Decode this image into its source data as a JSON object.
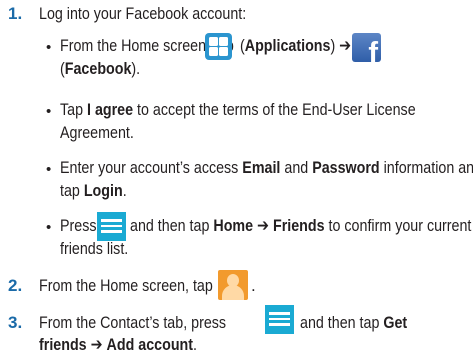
{
  "steps": [
    {
      "number": "1.",
      "text": "Log into your Facebook account:"
    },
    {
      "number": "2.",
      "text": "From the Home screen, tap",
      "end": "."
    },
    {
      "number": "3.",
      "line1_a": "From the Contact’s tab, press",
      "line1_b": "and then tap",
      "get": "Get",
      "friends": "friends",
      "arrow": "➔",
      "add_account": "Add account",
      "end": "."
    }
  ],
  "bullets": {
    "symbol": "•",
    "b1": {
      "a": "From the Home screen, tap",
      "paren_open": "(",
      "applications": "Applications",
      "paren_close_arrow": ") ➔",
      "line2_open": "(",
      "facebook": "Facebook",
      "line2_close": ")."
    },
    "b2": {
      "a": "Tap",
      "agree": "I agree",
      "b": "to accept the terms of the End-User License",
      "line2": "Agreement."
    },
    "b3": {
      "a": "Enter your account’s access",
      "email": "Email",
      "and": "and",
      "password": "Password",
      "b": "information and",
      "line2a": "tap",
      "login": "Login",
      "end": "."
    },
    "b4": {
      "a": "Press",
      "b": "and then tap",
      "home": "Home",
      "arrow": "➔",
      "friends": "Friends",
      "c": "to confirm your current",
      "line2": "friends list."
    }
  },
  "icons": [
    "applications-icon",
    "facebook-icon",
    "menu-key-icon",
    "contacts-icon"
  ],
  "colors": {
    "step_number": "#1a6aa8",
    "text": "#231f20",
    "app_blue": "#2b95cf",
    "facebook_blue": "#3b5998",
    "menu_cyan": "#1aaad3",
    "contacts_orange": "#f29a2d"
  }
}
